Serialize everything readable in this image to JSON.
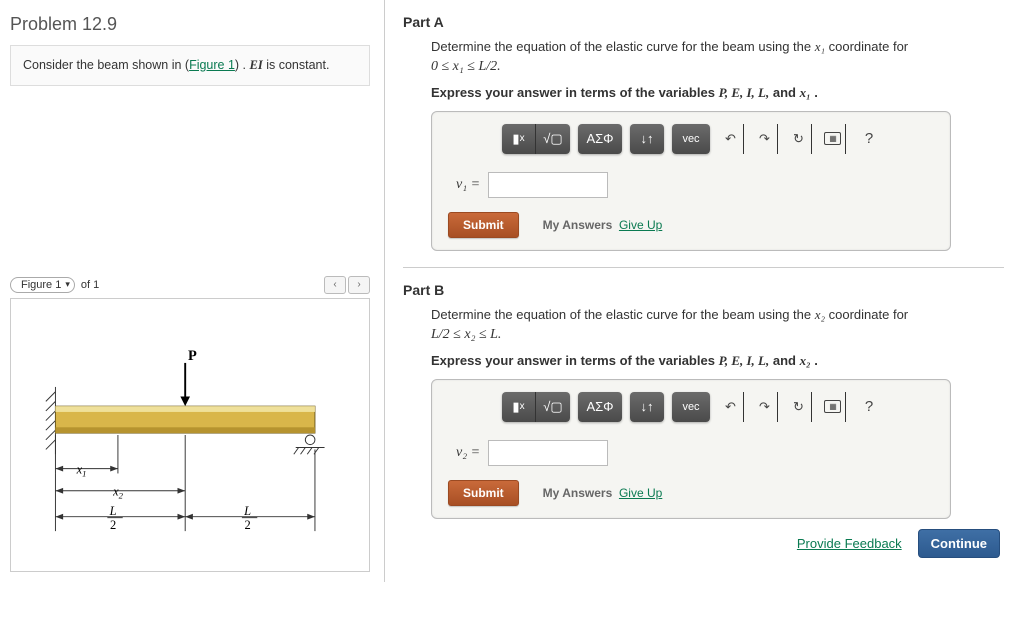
{
  "problem": {
    "title": "Problem 12.9",
    "prompt_prefix": "Consider the beam shown in (",
    "figure_link": "Figure 1",
    "prompt_suffix": ") . ",
    "ei_text": "EI",
    "prompt_tail": " is constant."
  },
  "figure": {
    "selector_label": "Figure 1",
    "of_text": "of 1",
    "nav_prev": "‹",
    "nav_next": "›",
    "labels": {
      "P": "P",
      "x1": "x",
      "x1_sub": "1",
      "x2": "x",
      "x2_sub": "2",
      "L_over_2_left": "L",
      "L_over_2_den": "2",
      "L_over_2_right": "L",
      "L_over_2_right_den": "2"
    }
  },
  "toolbar": {
    "template_icon": "▮",
    "sqrt_icon": "√▢",
    "fraction_sup": "x",
    "greek": "ΑΣΦ",
    "updown": "↓↑",
    "vec": "vec",
    "undo": "↶",
    "redo": "↷",
    "reset": "↻",
    "keyboard": "⌨",
    "help": "?"
  },
  "buttons": {
    "submit": "Submit",
    "my_answers": "My Answers",
    "give_up": "Give Up",
    "provide_feedback": "Provide Feedback",
    "continue": "Continue"
  },
  "partA": {
    "title": "Part A",
    "desc_prefix": "Determine the equation of the elastic curve for the beam using the ",
    "var": "x₁",
    "desc_suffix": " coordinate for",
    "range": "0 ≤ x₁ ≤ L/2.",
    "hint_prefix": "Express your answer in terms of the variables ",
    "vars_list": "P, E, I, L,",
    "hint_and": " and ",
    "hint_var": "x₁",
    "hint_period": " .",
    "eq_lhs": "v₁ ="
  },
  "partB": {
    "title": "Part B",
    "desc_prefix": "Determine the equation of the elastic curve for the beam using the ",
    "var": "x₂",
    "desc_suffix": " coordinate for",
    "range": "L/2 ≤ x₂ ≤ L.",
    "hint_prefix": "Express your answer in terms of the variables ",
    "vars_list": "P, E, I, L,",
    "hint_and": " and ",
    "hint_var": "x₂",
    "hint_period": " .",
    "eq_lhs": "v₂ ="
  }
}
